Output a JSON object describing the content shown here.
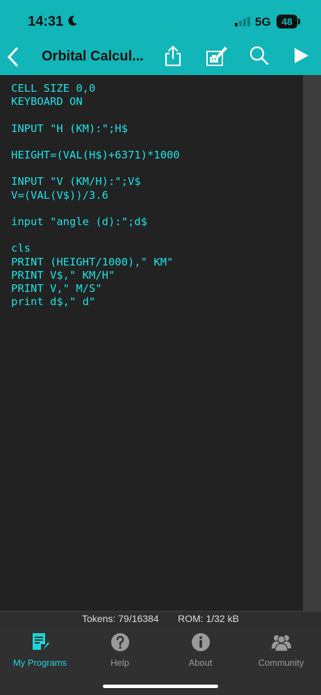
{
  "status_bar": {
    "time": "14:31",
    "network": "5G",
    "battery": "48"
  },
  "nav": {
    "title": "Orbital Calcul...",
    "accent_color": "#12b5b8"
  },
  "editor": {
    "text_color": "#1fe3e6",
    "code_lines": [
      "CELL SIZE 0,0",
      "KEYBOARD ON",
      "",
      "INPUT \"H (KM):\";H$",
      "",
      "HEIGHT=(VAL(H$)+6371)*1000",
      "",
      "INPUT \"V (KM/H):\";V$",
      "V=(VAL(V$))/3.6",
      "",
      "input \"angle (d):\";d$",
      "",
      "cls",
      "PRINT (HEIGHT/1000),\" KM\"",
      "PRINT V$,\" KM/H\"",
      "PRINT V,\" M/S\"",
      "print d$,\" d\""
    ]
  },
  "info_bar": {
    "tokens": "Tokens: 79/16384",
    "rom": "ROM: 1/32 kB"
  },
  "tabs": [
    {
      "label": "My Programs",
      "icon": "programs-icon",
      "active": true
    },
    {
      "label": "Help",
      "icon": "help-icon",
      "active": false
    },
    {
      "label": "About",
      "icon": "info-icon",
      "active": false
    },
    {
      "label": "Community",
      "icon": "community-icon",
      "active": false
    }
  ]
}
